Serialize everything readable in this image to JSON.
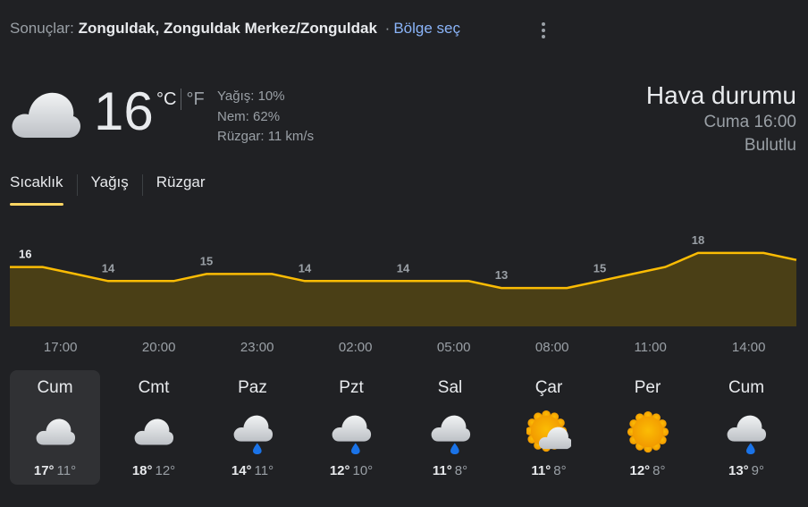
{
  "header": {
    "prefix": "Sonuçlar:",
    "location": "Zonguldak, Zonguldak Merkez/Zonguldak",
    "separator": "·",
    "region_link": "Bölge seç"
  },
  "current": {
    "icon": "cloudy-icon",
    "temp": "16",
    "unit_c": "°C",
    "unit_f": "°F",
    "precip": "Yağış: 10%",
    "humidity": "Nem: 62%",
    "wind": "Rüzgar: 11 km/s"
  },
  "summary": {
    "title": "Hava durumu",
    "time": "Cuma 16:00",
    "condition": "Bulutlu"
  },
  "tabs": [
    {
      "label": "Sıcaklık",
      "active": true
    },
    {
      "label": "Yağış",
      "active": false
    },
    {
      "label": "Rüzgar",
      "active": false
    }
  ],
  "chart_data": {
    "type": "area",
    "x": [
      "16:00",
      "17:00",
      "18:00",
      "19:00",
      "20:00",
      "21:00",
      "22:00",
      "23:00",
      "00:00",
      "01:00",
      "02:00",
      "03:00",
      "04:00",
      "05:00",
      "06:00",
      "07:00",
      "08:00",
      "09:00",
      "10:00",
      "11:00",
      "12:00",
      "13:00",
      "14:00",
      "15:00",
      "16:00"
    ],
    "values": [
      16,
      16,
      15,
      14,
      14,
      14,
      15,
      15,
      15,
      14,
      14,
      14,
      14,
      14,
      14,
      13,
      13,
      13,
      14,
      15,
      16,
      18,
      18,
      18,
      17
    ],
    "labeled_points": [
      {
        "x": "16:00",
        "label": "16"
      },
      {
        "x": "19:00",
        "label": "14"
      },
      {
        "x": "22:00",
        "label": "15"
      },
      {
        "x": "01:00",
        "label": "14"
      },
      {
        "x": "04:00",
        "label": "14"
      },
      {
        "x": "07:00",
        "label": "13"
      },
      {
        "x": "10:00",
        "label": "15"
      },
      {
        "x": "13:00",
        "label": "18"
      }
    ],
    "tick_labels": [
      "17:00",
      "20:00",
      "23:00",
      "02:00",
      "05:00",
      "08:00",
      "11:00",
      "14:00"
    ],
    "line_color": "#fbbc04",
    "fill_color": "#4a3f16"
  },
  "days": [
    {
      "name": "Cum",
      "icon": "cloudy-icon",
      "hi": "17°",
      "lo": "11°",
      "selected": true
    },
    {
      "name": "Cmt",
      "icon": "cloudy-icon",
      "hi": "18°",
      "lo": "12°",
      "selected": false
    },
    {
      "name": "Paz",
      "icon": "rain-icon",
      "hi": "14°",
      "lo": "11°",
      "selected": false
    },
    {
      "name": "Pzt",
      "icon": "rain-icon",
      "hi": "12°",
      "lo": "10°",
      "selected": false
    },
    {
      "name": "Sal",
      "icon": "rain-icon",
      "hi": "11°",
      "lo": "8°",
      "selected": false
    },
    {
      "name": "Çar",
      "icon": "partly-sunny-icon",
      "hi": "11°",
      "lo": "8°",
      "selected": false
    },
    {
      "name": "Per",
      "icon": "sunny-icon",
      "hi": "12°",
      "lo": "8°",
      "selected": false
    },
    {
      "name": "Cum",
      "icon": "rain-icon",
      "hi": "13°",
      "lo": "9°",
      "selected": false
    }
  ]
}
